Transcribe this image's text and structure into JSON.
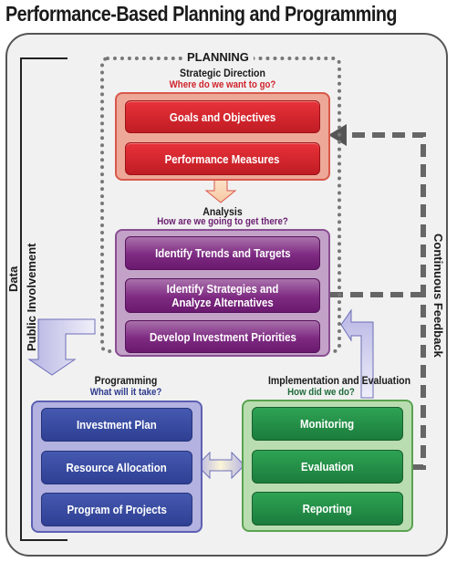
{
  "title": "Performance-Based Planning and Programming",
  "side_labels": {
    "data": "Data",
    "public_involvement": "Public Involvement",
    "continuous_feedback": "Continuous Feedback"
  },
  "planning": {
    "label": "PLANNING",
    "strategic_direction": {
      "heading": "Strategic Direction",
      "question": "Where do we want to go?",
      "items": [
        "Goals and Objectives",
        "Performance Measures"
      ]
    },
    "analysis": {
      "heading": "Analysis",
      "question": "How are we going to get there?",
      "items": [
        "Identify Trends and Targets",
        "Identify Strategies and Analyze Alternatives",
        "Develop Investment Priorities"
      ]
    }
  },
  "programming": {
    "heading": "Programming",
    "question": "What will it take?",
    "items": [
      "Investment Plan",
      "Resource Allocation",
      "Program of Projects"
    ]
  },
  "implementation": {
    "heading": "Implementation and Evaluation",
    "question": "How did we do?",
    "items": [
      "Monitoring",
      "Evaluation",
      "Reporting"
    ]
  },
  "colors": {
    "strategic": "#c8202a",
    "analysis": "#7e2a82",
    "programming": "#2e3f93",
    "implementation": "#1b7c3c",
    "strategic_question": "#d0242c",
    "analysis_question": "#6b1f70",
    "programming_question": "#2d3a8c",
    "implementation_question": "#1f6b3a"
  }
}
